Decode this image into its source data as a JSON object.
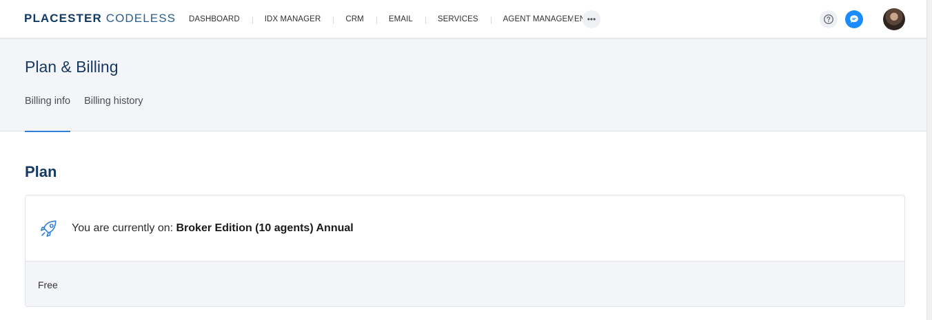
{
  "nav": {
    "brand_bold": "PLACESTER",
    "brand_light": "CODELESS",
    "links": [
      "DASHBOARD",
      "IDX MANAGER",
      "CRM",
      "EMAIL",
      "SERVICES",
      "AGENT MANAGEMENT"
    ],
    "more_label": "•••",
    "help_icon": "help-circle-icon",
    "chat_icon": "chat-bubble-icon"
  },
  "page": {
    "title": "Plan & Billing",
    "tabs": [
      {
        "label": "Billing info",
        "active": true
      },
      {
        "label": "Billing history",
        "active": false
      }
    ]
  },
  "plan": {
    "section_title": "Plan",
    "icon": "rocket-icon",
    "current_prefix": "You are currently on: ",
    "plan_name": "Broker Edition (10 agents) Annual",
    "price": "Free"
  },
  "colors": {
    "brand": "#0f3a68",
    "accent": "#2f7ed8",
    "chat": "#1a8cff",
    "band": "#f4f5f9"
  }
}
